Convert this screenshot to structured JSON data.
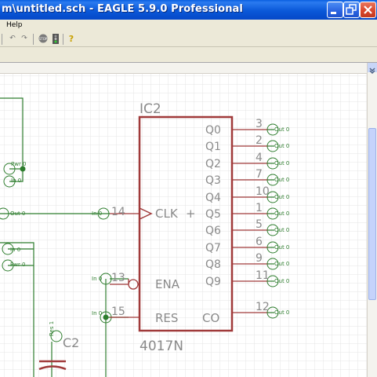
{
  "window": {
    "title": "m\\untitled.sch - EAGLE 5.9.0 Professional"
  },
  "menu": {
    "help": "Help"
  },
  "toolbar": {
    "stop": "STOP",
    "help_icon": "?"
  },
  "schematic": {
    "ic": {
      "name": "IC2",
      "value": "4017N"
    },
    "pins_right": [
      {
        "label": "Q0",
        "num": "3",
        "net": "Out 0"
      },
      {
        "label": "Q1",
        "num": "2",
        "net": "Out 0"
      },
      {
        "label": "Q2",
        "num": "4",
        "net": "Out 0"
      },
      {
        "label": "Q3",
        "num": "7",
        "net": "Out 0"
      },
      {
        "label": "Q4",
        "num": "10",
        "net": "Out 0"
      },
      {
        "label": "Q5",
        "num": "1",
        "net": "Out 0"
      },
      {
        "label": "Q6",
        "num": "5",
        "net": "Out 0"
      },
      {
        "label": "Q7",
        "num": "6",
        "net": "Out 0"
      },
      {
        "label": "Q8",
        "num": "9",
        "net": "Out 0"
      },
      {
        "label": "Q9",
        "num": "11",
        "net": "Out 0"
      }
    ],
    "pin_co": {
      "label": "CO",
      "num": "12",
      "net": "Out 0"
    },
    "pin_clk": {
      "label": "CLK",
      "num": "14",
      "net": "In 0"
    },
    "pin_ena": {
      "label": "ENA",
      "num": "13",
      "net": "In 0"
    },
    "pin_res": {
      "label": "RES",
      "num": "15",
      "net": "In 0"
    },
    "left_labels": {
      "pwr_top": "Pwr 0",
      "in_top": "In 0",
      "out_mid": "Out 0",
      "in_mid": "In 0",
      "pwr_mid": "Pwr 0",
      "plus": "+"
    },
    "cap": {
      "name": "C2",
      "net": "Res 1"
    }
  },
  "colors": {
    "wire": "#2e7d2e",
    "part": "#a03a3a",
    "pinlabel": "#8a8a8a",
    "grid": "#e6e6e6"
  }
}
